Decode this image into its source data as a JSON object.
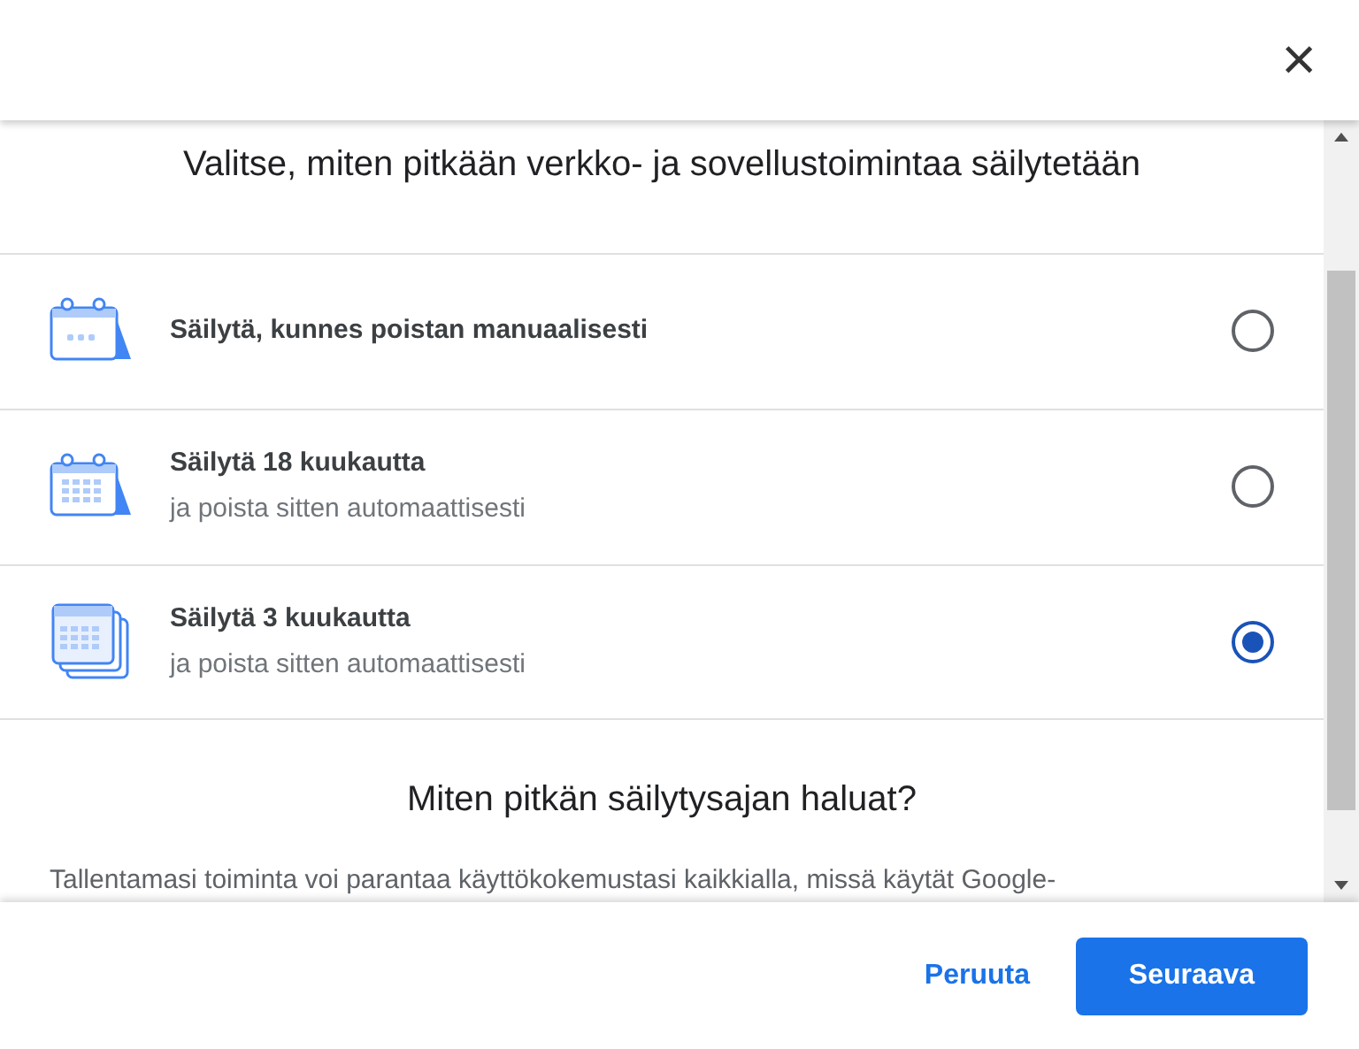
{
  "dialog": {
    "close_icon": "×",
    "title": "Valitse, miten pitkään verkko- ja sovellustoimintaa säilytetään",
    "options": [
      {
        "kind": "manual",
        "label": "Säilytä, kunnes poistan manuaalisesti",
        "selected": false
      },
      {
        "kind": "months",
        "label": "Säilytä 18 kuukautta",
        "sublabel": "ja poista sitten automaattisesti",
        "selected": false
      },
      {
        "kind": "stack",
        "label": "Säilytä 3 kuukautta",
        "sublabel": "ja poista sitten automaattisesti",
        "selected": true
      }
    ],
    "section_heading": "Miten pitkän säilytysajan haluat?",
    "paragraph": "Tallentamasi toiminta voi parantaa käyttökokemustasi kaikkialla, missä käytät Google-",
    "buttons": [
      {
        "kind": "text",
        "label": "Peruuta"
      },
      {
        "kind": "primary",
        "label": "Seuraava"
      }
    ]
  }
}
